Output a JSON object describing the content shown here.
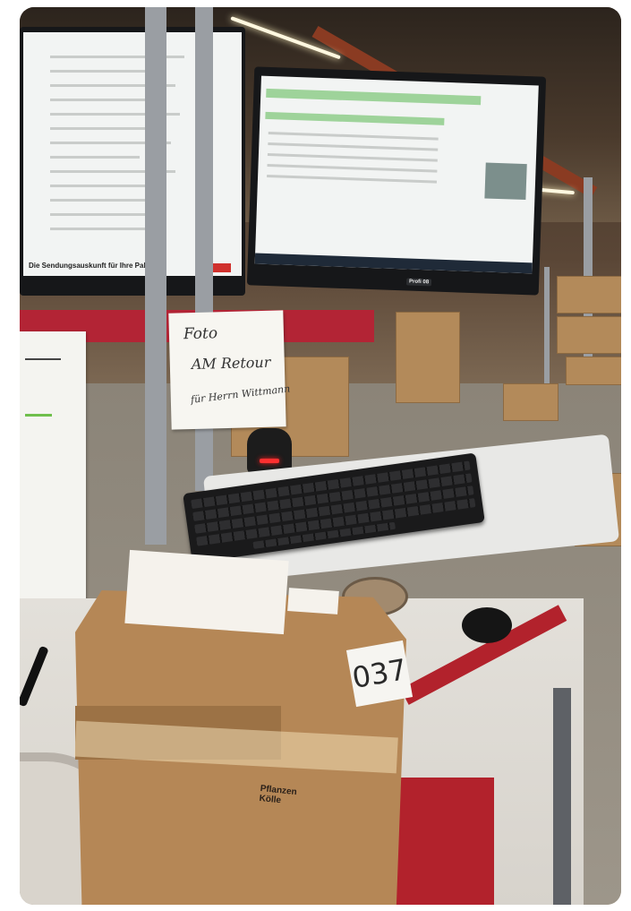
{
  "left_monitor": {
    "heading": "Die Sendungsauskunft für Ihre Pakete"
  },
  "right_monitor": {
    "bottom_labels": [
      "Profi 08"
    ]
  },
  "sign": {
    "lines": [
      "Foto",
      "AM Retour",
      "für Herrn Wittmann"
    ]
  },
  "parcel": {
    "number": "037",
    "brand_print": "Pflanzen Kölle"
  },
  "colors": {
    "shelf_red": "#b32435",
    "led_red": "#ff3030",
    "cardboard": "#b58756"
  }
}
